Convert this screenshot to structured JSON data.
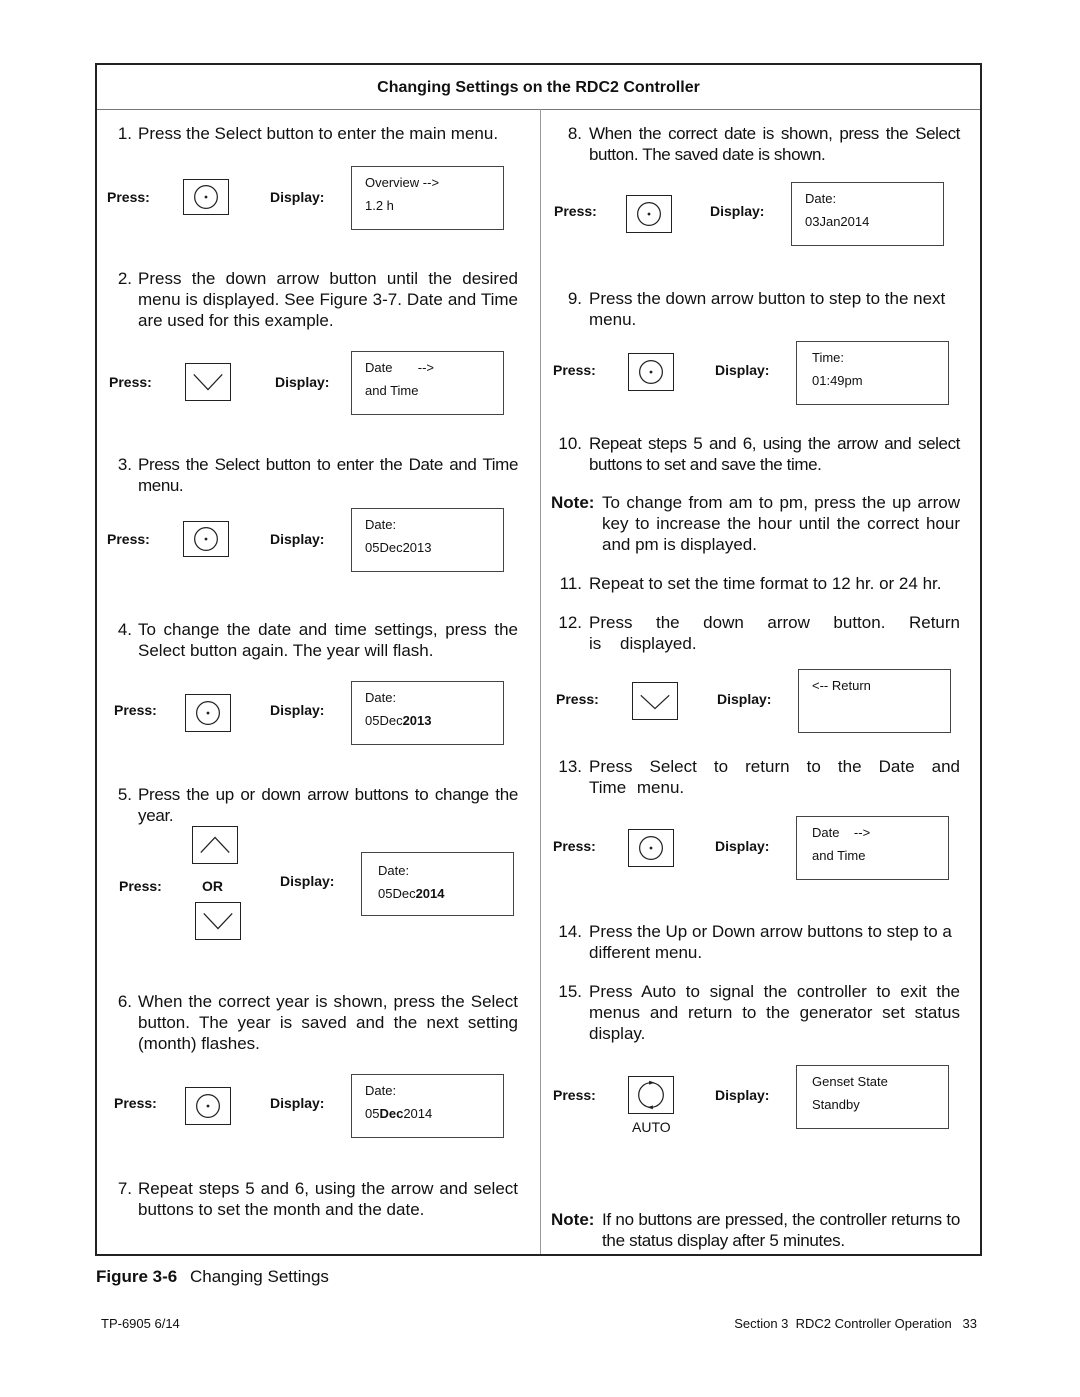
{
  "panel": {
    "title": "Changing Settings on the RDC2 Controller"
  },
  "labels": {
    "press": "Press:",
    "display": "Display:",
    "or": "OR",
    "auto": "AUTO"
  },
  "steps": {
    "s1": {
      "num": "1.",
      "text": "Press the Select button to enter the main menu.",
      "button": "select",
      "display": [
        "Overview -->",
        "1.2 h"
      ]
    },
    "s2": {
      "num": "2.",
      "text": "Press the down arrow button until the desired menu is displayed. See Figure 3-7. Date and Time are used for this example.",
      "button": "down-arrow",
      "display": [
        "Date       -->",
        "and Time"
      ]
    },
    "s3": {
      "num": "3.",
      "text": "Press the Select button to enter the Date and Time menu.",
      "button": "select",
      "display": [
        "Date:",
        "05Dec2013"
      ]
    },
    "s4": {
      "num": "4.",
      "text": "To change the date and time settings, press the Select button again. The year will flash.",
      "button": "select",
      "display": [
        "Date:",
        "05Dec",
        "2013"
      ]
    },
    "s5": {
      "num": "5.",
      "text": "Press the up or down arrow buttons to change the year.",
      "button": "up-or-down-arrow",
      "display": [
        "Date:",
        "05Dec",
        "2014"
      ]
    },
    "s6": {
      "num": "6.",
      "text": "When the correct year is shown, press the Select button. The year is saved and the next setting (month) flashes.",
      "button": "select",
      "display": [
        "Date:",
        "05",
        "Dec",
        "2014"
      ]
    },
    "s7": {
      "num": "7.",
      "text": "Repeat steps 5 and 6, using the arrow and select buttons to set the month and the date."
    },
    "s8": {
      "num": "8.",
      "text": "When the correct date is shown, press the Select button. The saved date is shown.",
      "button": "select",
      "display": [
        "Date:",
        "03Jan2014"
      ]
    },
    "s9": {
      "num": "9.",
      "text": "Press the down arrow button to step to the next menu.",
      "button": "select",
      "display": [
        "Time:",
        "01:49pm"
      ]
    },
    "s10": {
      "num": "10.",
      "text": "Repeat steps 5 and 6, using the arrow and select buttons to set and save the time."
    },
    "s11": {
      "num": "11.",
      "text": "Repeat to set the time format to 12 hr. or 24 hr."
    },
    "s12": {
      "num": "12.",
      "text": "Press the down arrow button. Return is displayed.",
      "button": "down-arrow",
      "display": [
        "<-- Return",
        ""
      ]
    },
    "s13": {
      "num": "13.",
      "text": "Press Select to return to the Date and Time menu.",
      "button": "select",
      "display": [
        "Date    -->",
        "and Time"
      ]
    },
    "s14": {
      "num": "14.",
      "text": "Press the Up or Down arrow buttons to step to a different menu."
    },
    "s15": {
      "num": "15.",
      "text": "Press Auto to signal the controller to exit the menus and return to the generator set status display.",
      "button": "auto",
      "display": [
        "Genset State",
        "Standby"
      ]
    }
  },
  "notes": {
    "n1": {
      "label": "Note:",
      "text": "To change from am to pm, press the up arrow key to increase the hour until the correct hour and pm is displayed."
    },
    "n2": {
      "label": "Note:",
      "text": "If no buttons are pressed, the controller returns to the status display after 5 minutes."
    }
  },
  "caption": {
    "figure": "Figure 3-6",
    "text": "Changing Settings"
  },
  "footer": {
    "left": "TP-6905 6/14",
    "right": "Section 3  RDC2 Controller Operation   33"
  }
}
